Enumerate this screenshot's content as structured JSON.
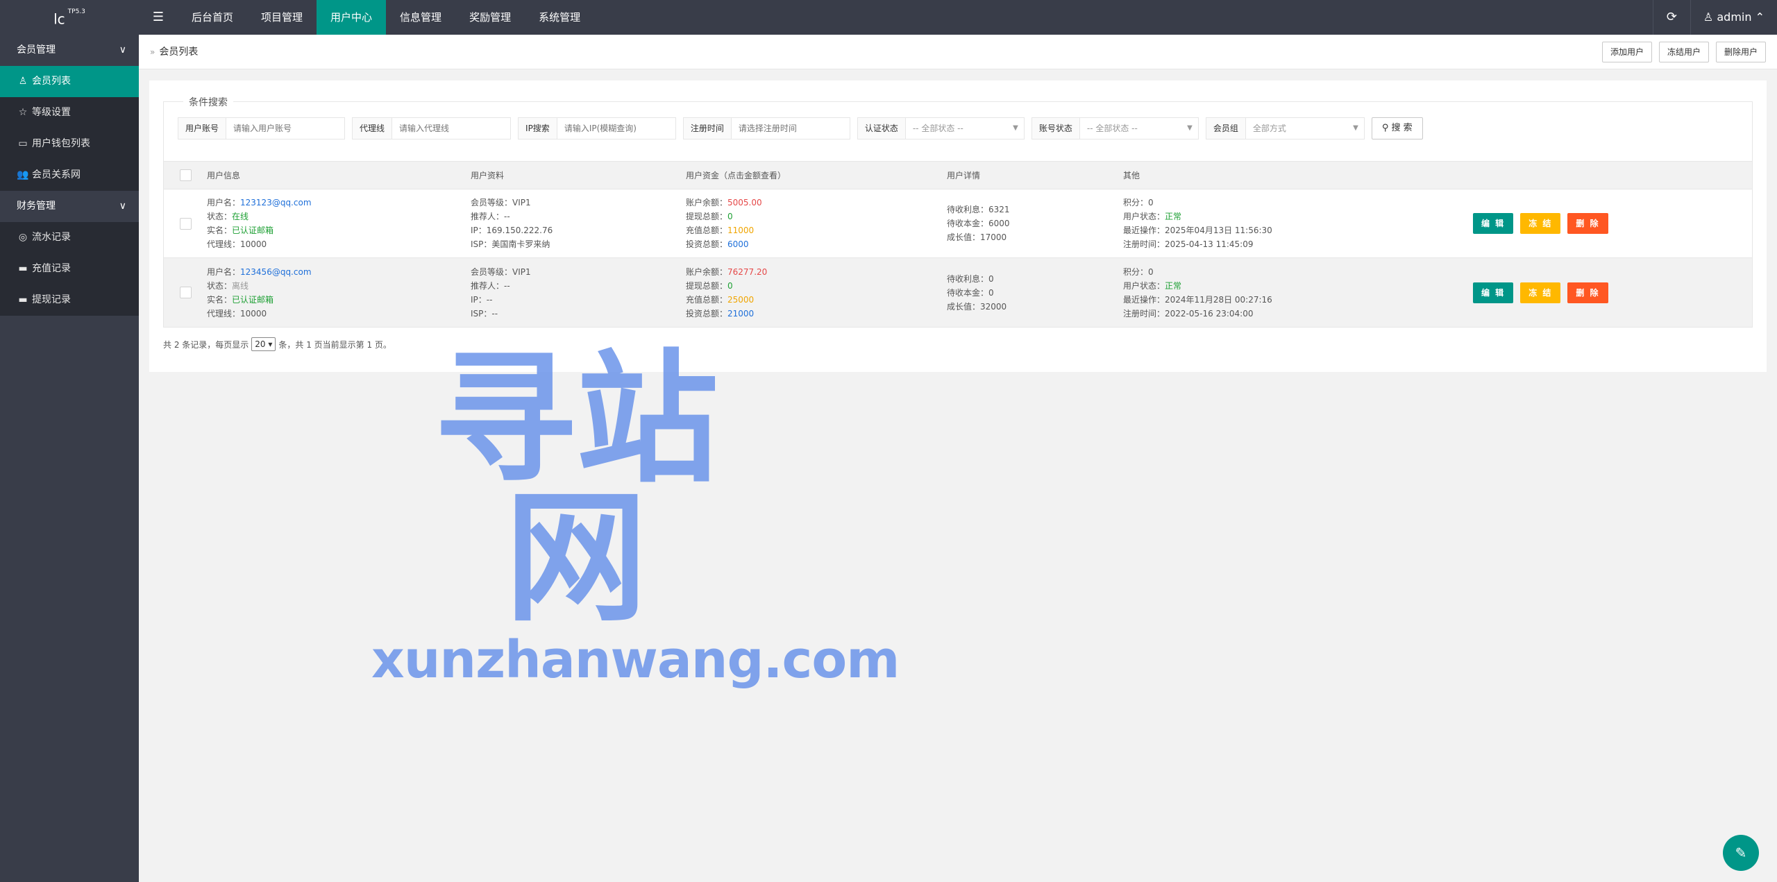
{
  "header": {
    "logo": "lc",
    "logo_sup": "TP5.3",
    "menu_icon": "☰",
    "nav": [
      "后台首页",
      "项目管理",
      "用户中心",
      "信息管理",
      "奖励管理",
      "系统管理"
    ],
    "active_nav": "用户中心",
    "refresh_icon": "⟳",
    "user": "admin",
    "user_caret": "⌃"
  },
  "sidebar": {
    "group1": "会员管理",
    "group1_items": [
      {
        "label": "会员列表",
        "icon": "♙"
      },
      {
        "label": "等级设置",
        "icon": "☆"
      },
      {
        "label": "用户钱包列表",
        "icon": "▭"
      },
      {
        "label": "会员关系网",
        "icon": "👥"
      }
    ],
    "group2": "财务管理",
    "group2_items": [
      {
        "label": "流水记录",
        "icon": "◎"
      },
      {
        "label": "充值记录",
        "icon": "▬"
      },
      {
        "label": "提现记录",
        "icon": "▬"
      }
    ],
    "chevron": "∨"
  },
  "breadcrumb": {
    "sep": "»",
    "current": "会员列表",
    "actions": [
      "添加用户",
      "冻结用户",
      "删除用户"
    ]
  },
  "search": {
    "legend": "条件搜索",
    "filters": [
      {
        "label": "用户账号",
        "placeholder": "请输入用户账号"
      },
      {
        "label": "代理线",
        "placeholder": "请输入代理线"
      },
      {
        "label": "IP搜索",
        "placeholder": "请输入IP(模糊查询)"
      },
      {
        "label": "注册时间",
        "placeholder": "请选择注册时间"
      }
    ],
    "selects": [
      {
        "label": "认证状态",
        "value": "-- 全部状态 --"
      },
      {
        "label": "账号状态",
        "value": "-- 全部状态 --"
      },
      {
        "label": "会员组",
        "value": "全部方式"
      }
    ],
    "button": "搜 索",
    "button_icon": "⚲"
  },
  "table": {
    "headers": [
      "用户信息",
      "用户资料",
      "用户资金（点击金额查看）",
      "用户详情",
      "其他"
    ],
    "rows": [
      {
        "username": "123123@qq.com",
        "status": "在线",
        "realname": "已认证邮箱",
        "agent": "10000",
        "level": "VIP1",
        "referrer": "--",
        "ip": "169.150.222.76",
        "isp": "美国南卡罗来纳",
        "balance": "5005.00",
        "withdraw": "0",
        "recharge": "11000",
        "invest": "6000",
        "pending_interest": "6321",
        "pending_principal": "6000",
        "growth": "17000",
        "points": "0",
        "user_status": "正常",
        "last_op": "2025年04月13日 11:56:30",
        "reg_time": "2025-04-13 11:45:09"
      },
      {
        "username": "123456@qq.com",
        "status": "离线",
        "realname": "已认证邮箱",
        "agent": "10000",
        "level": "VIP1",
        "referrer": "--",
        "ip": "--",
        "isp": "--",
        "balance": "76277.20",
        "withdraw": "0",
        "recharge": "25000",
        "invest": "21000",
        "pending_interest": "0",
        "pending_principal": "0",
        "growth": "32000",
        "points": "0",
        "user_status": "正常",
        "last_op": "2024年11月28日 00:27:16",
        "reg_time": "2022-05-16 23:04:00"
      }
    ],
    "labels": {
      "username": "用户名：",
      "status": "状态：",
      "realname": "实名：",
      "agent": "代理线：",
      "level": "会员等级：",
      "referrer": "推荐人：",
      "ip": "IP：",
      "isp": "ISP：",
      "balance": "账户余额：",
      "withdraw": "提现总额：",
      "recharge": "充值总额：",
      "invest": "投资总额：",
      "pending_interest": "待收利息：",
      "pending_principal": "待收本金：",
      "growth": "成长值：",
      "points": "积分：",
      "user_status": "用户状态：",
      "last_op": "最近操作：",
      "reg_time": "注册时间："
    },
    "actions": [
      "编 辑",
      "冻 结",
      "删 除"
    ]
  },
  "pager": {
    "prefix": "共 2 条记录，每页显示",
    "per_page": "20",
    "suffix": "条，共 1 页当前显示第 1 页。"
  },
  "watermark": {
    "cn": "寻站网",
    "en": "xunzhanwang.com"
  },
  "float_icon": "✎"
}
